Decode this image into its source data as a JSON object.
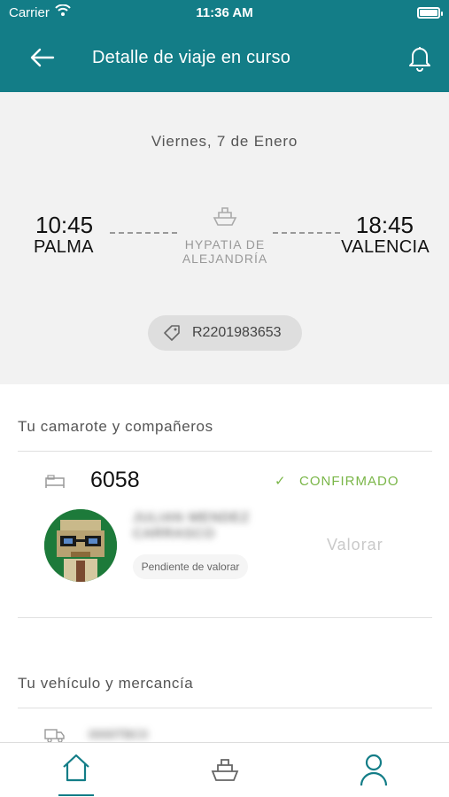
{
  "status_bar": {
    "carrier": "Carrier",
    "time": "11:36 AM"
  },
  "header": {
    "title": "Detalle de viaje en curso",
    "back_icon": "arrow-left-icon",
    "bell_icon": "bell-icon"
  },
  "trip": {
    "date": "Viernes, 7 de Enero",
    "departure": {
      "time": "10:45",
      "port": "PALMA"
    },
    "arrival": {
      "time": "18:45",
      "port": "VALENCIA"
    },
    "vessel": "HYPATIA DE ALEJANDRÍA",
    "booking_ref": "R2201983653"
  },
  "cabin_section": {
    "title": "Tu camarote y compañeros",
    "cabin_number": "6058",
    "status": "CONFIRMADO",
    "passenger": {
      "name_redacted": "JULIAN MENDEZ CARRASCO",
      "rating_status": "Pendiente de valorar",
      "rate_label": "Valorar"
    }
  },
  "vehicle_section": {
    "title": "Tu vehículo y mercancía",
    "plate_redacted": "0000TBC0"
  },
  "tabbar": {
    "items": [
      "home-icon",
      "ship-icon",
      "profile-icon"
    ],
    "active": "home-icon"
  },
  "colors": {
    "primary": "#137d87",
    "confirmed": "#7ab648",
    "trip_bg": "#f2f2f2"
  }
}
